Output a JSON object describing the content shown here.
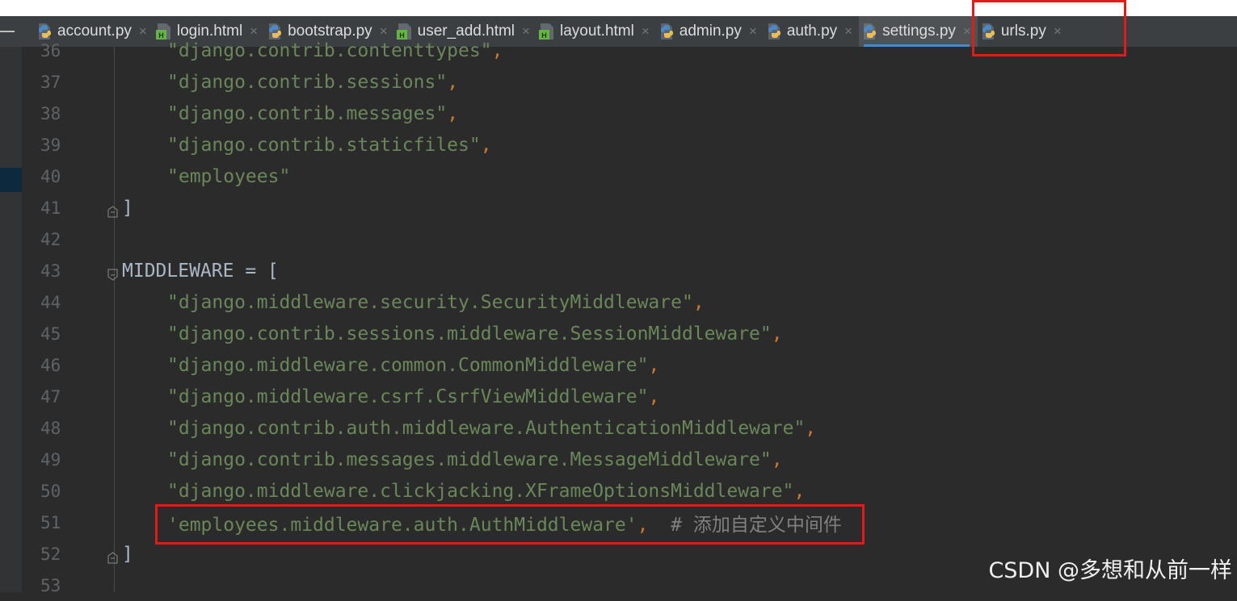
{
  "tabs": [
    {
      "label": "account.py",
      "kind": "python",
      "active": false
    },
    {
      "label": "login.html",
      "kind": "html",
      "active": false
    },
    {
      "label": "bootstrap.py",
      "kind": "python",
      "active": false
    },
    {
      "label": "user_add.html",
      "kind": "html",
      "active": false
    },
    {
      "label": "layout.html",
      "kind": "html",
      "active": false
    },
    {
      "label": "admin.py",
      "kind": "python",
      "active": false
    },
    {
      "label": "auth.py",
      "kind": "python",
      "active": false
    },
    {
      "label": "settings.py",
      "kind": "python",
      "active": true
    },
    {
      "label": "urls.py",
      "kind": "python",
      "active": false
    }
  ],
  "close_glyph": "×",
  "code_lines": [
    {
      "num": "36",
      "tokens": [
        {
          "t": "\"django.contrib.contenttypes\"",
          "c": "str"
        },
        {
          "t": ",",
          "c": "punc"
        }
      ]
    },
    {
      "num": "37",
      "tokens": [
        {
          "t": "\"django.contrib.sessions\"",
          "c": "str"
        },
        {
          "t": ",",
          "c": "punc"
        }
      ]
    },
    {
      "num": "38",
      "tokens": [
        {
          "t": "\"django.contrib.messages\"",
          "c": "str"
        },
        {
          "t": ",",
          "c": "punc"
        }
      ]
    },
    {
      "num": "39",
      "tokens": [
        {
          "t": "\"django.contrib.staticfiles\"",
          "c": "str"
        },
        {
          "t": ",",
          "c": "punc"
        }
      ]
    },
    {
      "num": "40",
      "tokens": [
        {
          "t": "\"employees\"",
          "c": "str"
        }
      ]
    },
    {
      "num": "41",
      "tokens": [
        {
          "t": "]",
          "c": "plain"
        }
      ]
    },
    {
      "num": "42",
      "tokens": []
    },
    {
      "num": "43",
      "tokens": [
        {
          "t": "MIDDLEWARE = [",
          "c": "plain"
        }
      ]
    },
    {
      "num": "44",
      "tokens": [
        {
          "t": "\"django.middleware.security.SecurityMiddleware\"",
          "c": "str"
        },
        {
          "t": ",",
          "c": "punc"
        }
      ]
    },
    {
      "num": "45",
      "tokens": [
        {
          "t": "\"django.contrib.sessions.middleware.SessionMiddleware\"",
          "c": "str"
        },
        {
          "t": ",",
          "c": "punc"
        }
      ]
    },
    {
      "num": "46",
      "tokens": [
        {
          "t": "\"django.middleware.common.CommonMiddleware\"",
          "c": "str"
        },
        {
          "t": ",",
          "c": "punc"
        }
      ]
    },
    {
      "num": "47",
      "tokens": [
        {
          "t": "\"django.middleware.csrf.CsrfViewMiddleware\"",
          "c": "str"
        },
        {
          "t": ",",
          "c": "punc"
        }
      ]
    },
    {
      "num": "48",
      "tokens": [
        {
          "t": "\"django.contrib.auth.middleware.AuthenticationMiddleware\"",
          "c": "str"
        },
        {
          "t": ",",
          "c": "punc"
        }
      ]
    },
    {
      "num": "49",
      "tokens": [
        {
          "t": "\"django.contrib.messages.middleware.MessageMiddleware\"",
          "c": "str"
        },
        {
          "t": ",",
          "c": "punc"
        }
      ]
    },
    {
      "num": "50",
      "tokens": [
        {
          "t": "\"django.middleware.clickjacking.XFrameOptionsMiddleware\"",
          "c": "str"
        },
        {
          "t": ",",
          "c": "punc"
        }
      ]
    },
    {
      "num": "51",
      "tokens": [
        {
          "t": "'employees.middleware.auth.AuthMiddleware'",
          "c": "str"
        },
        {
          "t": ",",
          "c": "punc"
        },
        {
          "t": "  # ",
          "c": "cmt"
        },
        {
          "t": "添加自定义中间件",
          "c": "cmt cjk"
        }
      ]
    },
    {
      "num": "52",
      "tokens": [
        {
          "t": "]",
          "c": "plain"
        }
      ]
    },
    {
      "num": "53",
      "tokens": []
    }
  ],
  "watermark": "CSDN @多想和从前一样",
  "colors": {
    "background": "#2b2b2b",
    "string": "#6a8759",
    "keyword_punct": "#cc7832",
    "plain": "#a9b7c6",
    "comment": "#808080",
    "line_number": "#606366",
    "highlight_box": "#e21a1a",
    "active_tab_underline": "#4a88c7"
  }
}
